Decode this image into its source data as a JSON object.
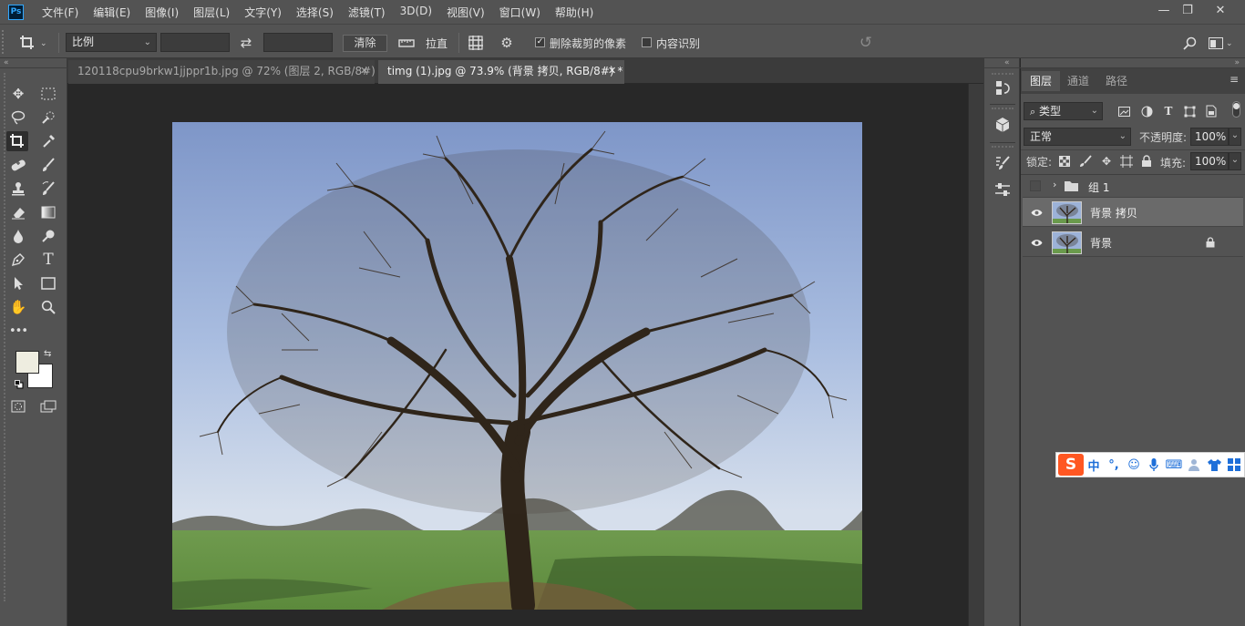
{
  "app": {
    "logo": "Ps"
  },
  "menu": [
    "文件(F)",
    "编辑(E)",
    "图像(I)",
    "图层(L)",
    "文字(Y)",
    "选择(S)",
    "滤镜(T)",
    "3D(D)",
    "视图(V)",
    "窗口(W)",
    "帮助(H)"
  ],
  "options": {
    "ratio_select": "比例",
    "width_value": "",
    "height_value": "",
    "clear_label": "清除",
    "straighten_label": "拉直",
    "delete_cropped_label": "删除裁剪的像素",
    "delete_cropped_checked": true,
    "content_aware_label": "内容识别",
    "content_aware_checked": false
  },
  "tabs": [
    {
      "label": "120118cpu9brkw1jjppr1b.jpg @ 72% (图层 2, RGB/8#) *",
      "active": false
    },
    {
      "label": "timg (1).jpg @ 73.9% (背景 拷贝, RGB/8#) *",
      "active": true
    }
  ],
  "layers_panel": {
    "tabs": [
      "图层",
      "通道",
      "路径"
    ],
    "filter_label": "类型",
    "blend_mode": "正常",
    "opacity_label": "不透明度:",
    "opacity_value": "100%",
    "lock_label": "锁定:",
    "fill_label": "填充:",
    "fill_value": "100%",
    "layers": [
      {
        "name": "组 1",
        "type": "group",
        "visible": false,
        "selected": false,
        "locked": false
      },
      {
        "name": "背景 拷贝",
        "type": "image",
        "visible": true,
        "selected": true,
        "locked": false
      },
      {
        "name": "背景",
        "type": "image",
        "visible": true,
        "selected": false,
        "locked": true
      }
    ]
  },
  "ime": {
    "mode": "中"
  },
  "colors": {
    "foreground": "#eeede0",
    "background": "#ffffff",
    "accent": "#31a8ff"
  }
}
